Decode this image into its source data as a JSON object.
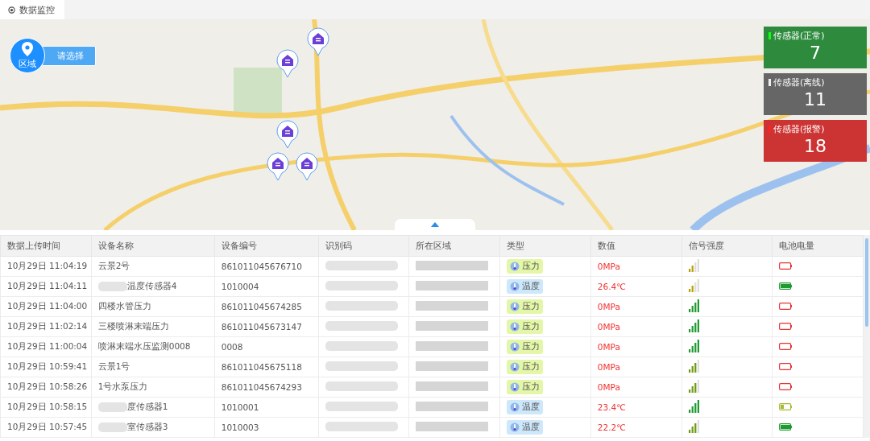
{
  "tabs": [
    {
      "label": "数据监控",
      "selected": true
    }
  ],
  "map": {
    "region_label": "区域",
    "region_select": "请选择"
  },
  "status_cards": [
    {
      "label": "传感器(正常)",
      "count": "7",
      "color": "#2e8b3e"
    },
    {
      "label": "传感器(离线)",
      "count": "11",
      "color": "#666666"
    },
    {
      "label": "传感器(报警)",
      "count": "18",
      "color": "#cc3333"
    }
  ],
  "table": {
    "columns": [
      "数据上传时间",
      "设备名称",
      "设备编号",
      "识别码",
      "所在区域",
      "类型",
      "数值",
      "信号强度",
      "电池电量"
    ],
    "rows": [
      {
        "time": "10月29日 11:04:19",
        "name": "云景2号",
        "name_redacted": false,
        "number": "861011045676710",
        "type": {
          "kind": "pressure",
          "label": "压力"
        },
        "value": "0MPa",
        "signal": {
          "kind": "weak"
        },
        "battery": {
          "kind": "low"
        }
      },
      {
        "time": "10月29日 11:04:11",
        "name": "温度传感器4",
        "name_redacted": true,
        "number": "1010004",
        "type": {
          "kind": "temperature",
          "label": "温度"
        },
        "value": "26.4℃",
        "signal": {
          "kind": "weak"
        },
        "battery": {
          "kind": "full"
        }
      },
      {
        "time": "10月29日 11:04:00",
        "name": "四楼水管压力",
        "name_redacted": false,
        "number": "861011045674285",
        "type": {
          "kind": "pressure",
          "label": "压力"
        },
        "value": "0MPa",
        "signal": {
          "kind": "strong"
        },
        "battery": {
          "kind": "low"
        }
      },
      {
        "time": "10月29日 11:02:14",
        "name": "三楼喷淋末端压力",
        "name_redacted": false,
        "number": "861011045673147",
        "type": {
          "kind": "pressure",
          "label": "压力"
        },
        "value": "0MPa",
        "signal": {
          "kind": "strong"
        },
        "battery": {
          "kind": "low"
        }
      },
      {
        "time": "10月29日 11:00:04",
        "name": "喷淋末端水压监测0008",
        "name_redacted": false,
        "number": "0008",
        "type": {
          "kind": "pressure",
          "label": "压力"
        },
        "value": "0MPa",
        "signal": {
          "kind": "strong"
        },
        "battery": {
          "kind": "low"
        }
      },
      {
        "time": "10月29日 10:59:41",
        "name": "云景1号",
        "name_redacted": false,
        "number": "861011045675118",
        "type": {
          "kind": "pressure",
          "label": "压力"
        },
        "value": "0MPa",
        "signal": {
          "kind": "fair"
        },
        "battery": {
          "kind": "low"
        }
      },
      {
        "time": "10月29日 10:58:26",
        "name": "1号水泵压力",
        "name_redacted": false,
        "number": "861011045674293",
        "type": {
          "kind": "pressure",
          "label": "压力"
        },
        "value": "0MPa",
        "signal": {
          "kind": "fair"
        },
        "battery": {
          "kind": "low"
        }
      },
      {
        "time": "10月29日 10:58:15",
        "name": "度传感器1",
        "name_redacted": true,
        "number": "1010001",
        "type": {
          "kind": "temperature",
          "label": "温度"
        },
        "value": "23.4℃",
        "signal": {
          "kind": "strong"
        },
        "battery": {
          "kind": "mid"
        }
      },
      {
        "time": "10月29日 10:57:45",
        "name": "室传感器3",
        "name_redacted": true,
        "number": "1010003",
        "type": {
          "kind": "temperature",
          "label": "温度"
        },
        "value": "22.2℃",
        "signal": {
          "kind": "fair"
        },
        "battery": {
          "kind": "full"
        }
      }
    ]
  }
}
